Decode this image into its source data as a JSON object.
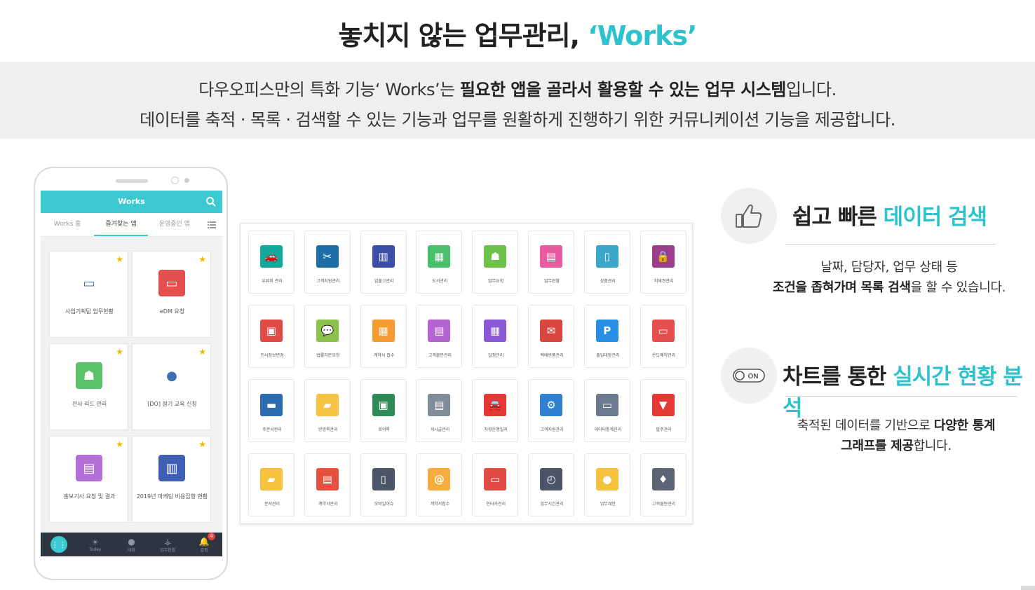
{
  "header": {
    "title_main": "놓치지 않는 업무관리, ",
    "title_accent": "‘Works’"
  },
  "intro": {
    "line1_a": "다우오피스만의 특화 기능‘ Works’는 ",
    "line1_bold": "필요한 앱을 골라서 활용할 수 있는 업무 시스템",
    "line1_b": "입니다.",
    "line2": "데이터를 축적 · 목록 · 검색할 수 있는 기능과 업무를 원활하게 진행하기 위한 커뮤니케이션 기능을 제공합니다."
  },
  "phone": {
    "app_title": "Works",
    "tabs": [
      "Works 홈",
      "즐겨찾는 앱",
      "운영중인 앱"
    ],
    "cards": [
      {
        "label": "사업기획팀 업무현황",
        "icon": "presentation-icon",
        "color": "#ffffff"
      },
      {
        "label": "eDM 요청",
        "icon": "monitor-icon",
        "color": "#e5504f"
      },
      {
        "label": "전사 리드 관리",
        "icon": "team-icon",
        "color": "#5cc26a"
      },
      {
        "label": "[DO] 정기 교육 신청",
        "icon": "user-icon",
        "color": "#ffffff"
      },
      {
        "label": "홍보기사 요청 및 결과",
        "icon": "document-icon",
        "color": "#b46fd6"
      },
      {
        "label": "2019년 마케팅 비용집행 현황",
        "icon": "bar-chart-icon",
        "color": "#3f5fb5"
      }
    ],
    "bottom_nav": [
      "",
      "Today",
      "대화",
      "업무현황",
      "알림"
    ],
    "notification_count": "4"
  },
  "app_grid": {
    "tiles": [
      {
        "label": "유류비 관리",
        "icon": "car-icon",
        "color": "#13a89e"
      },
      {
        "label": "고객지원관리",
        "icon": "tools-icon",
        "color": "#1e6ea7"
      },
      {
        "label": "입출고관리",
        "icon": "bar-chart-icon",
        "color": "#3b4fa8"
      },
      {
        "label": "도서관리",
        "icon": "books-icon",
        "color": "#48c06c"
      },
      {
        "label": "업무요청",
        "icon": "team-icon",
        "color": "#6cc24a"
      },
      {
        "label": "업무현황",
        "icon": "inbox-icon",
        "color": "#e95aa0"
      },
      {
        "label": "상품관리",
        "icon": "tag-icon",
        "color": "#3aa6c9"
      },
      {
        "label": "지재권관리",
        "icon": "lock-icon",
        "color": "#9c3d8d"
      },
      {
        "label": "인사정보변경",
        "icon": "contact-icon",
        "color": "#e04b45"
      },
      {
        "label": "법률자문요청",
        "icon": "chat-icon",
        "color": "#8bc34a"
      },
      {
        "label": "계약서 접수",
        "icon": "calculator-icon",
        "color": "#f59b32"
      },
      {
        "label": "고객불문관리",
        "icon": "document-icon",
        "color": "#b364d1"
      },
      {
        "label": "일정관리",
        "icon": "calendar-icon",
        "color": "#8a5ad6"
      },
      {
        "label": "택배반품관리",
        "icon": "envelope-icon",
        "color": "#d9453f"
      },
      {
        "label": "출입대장관리",
        "icon": "parking-icon",
        "color": "#2b8ee6"
      },
      {
        "label": "온도예약관리",
        "icon": "monitor-icon",
        "color": "#e5504f"
      },
      {
        "label": "주문서관리",
        "icon": "card-icon",
        "color": "#2b6cb0"
      },
      {
        "label": "방명록관리",
        "icon": "memo-icon",
        "color": "#f6c343"
      },
      {
        "label": "회의록",
        "icon": "message-icon",
        "color": "#2e8b57"
      },
      {
        "label": "게시글관리",
        "icon": "newspaper-icon",
        "color": "#7f8c9a"
      },
      {
        "label": "차량운행일지",
        "icon": "vehicle-icon",
        "color": "#e53935"
      },
      {
        "label": "고객지원관리",
        "icon": "gear-icon",
        "color": "#2f80d1"
      },
      {
        "label": "데이터통계관리",
        "icon": "presentation-icon",
        "color": "#6b7a8f"
      },
      {
        "label": "발주관리",
        "icon": "shopping-bag-icon",
        "color": "#e53935"
      },
      {
        "label": "문서관리",
        "icon": "folder-icon",
        "color": "#f7c23d"
      },
      {
        "label": "계약서관리",
        "icon": "clipboard-icon",
        "color": "#e94f3d"
      },
      {
        "label": "모바일어슈",
        "icon": "mobile-icon",
        "color": "#4a5568"
      },
      {
        "label": "계약서접수",
        "icon": "mail-icon",
        "color": "#f6ad3d"
      },
      {
        "label": "인터가관리",
        "icon": "display-icon",
        "color": "#e04b45"
      },
      {
        "label": "업무시간관리",
        "icon": "clock-icon",
        "color": "#4a5568"
      },
      {
        "label": "업무제안",
        "icon": "lightbulb-icon",
        "color": "#f6c23d"
      },
      {
        "label": "고객불만관리",
        "icon": "microphone-icon",
        "color": "#5a6473"
      }
    ]
  },
  "features": [
    {
      "icon": "thumbs-up-icon",
      "title_plain": "쉽고 빠른 ",
      "title_accent": "데이터 검색",
      "desc_line1": "날짜, 담당자, 업무 상태 등",
      "desc_line2_bold": "조건을 좁혀가며 목록 검색",
      "desc_line2_rest": "을 할 수 있습니다."
    },
    {
      "icon": "toggle-on-icon",
      "toggle_text": "ON",
      "title_plain": "차트를 통한 ",
      "title_accent": "실시간 현황 분석",
      "desc_line1_plain": "축적된 데이터를 기반으로 ",
      "desc_line1_bold": "다양한 통계",
      "desc_line2_bold": "그래프를 제공",
      "desc_line2_rest": "합니다."
    }
  ],
  "colors": {
    "accent": "#2cc3cf",
    "band": "#efefef",
    "appbar": "#3cc9d1"
  }
}
